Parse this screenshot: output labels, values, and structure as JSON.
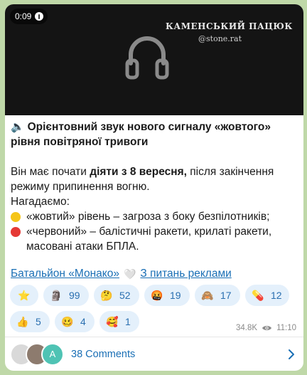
{
  "media": {
    "duration": "0:09",
    "watermark_title": "КАМЕНСЬКИЙ ПАЦЮК",
    "watermark_sub": "@stone.rat"
  },
  "post": {
    "title": "🔈 Орієнтовний звук нового сигналу «жовтого» рівня повітряної тривоги",
    "line1_pre": "Він має почати ",
    "line1_bold": "діяти з 8 вересня,",
    "line1_post": " після закінчення режиму припинення вогню.",
    "remind": "Нагадаємо:",
    "yellow_item": "«жовтий» рівень – загроза з боку безпілотників;",
    "red_item": "«червоний» – балістичні ракети, крилаті ракети, масовані атаки БПЛА.",
    "link1": "Батальйон «Монако»",
    "link2": "З питань реклами",
    "colors": {
      "yellow": "#f5c518",
      "red": "#e53935",
      "link": "#1a6fb5"
    }
  },
  "reactions": [
    {
      "emoji": "⭐",
      "count": ""
    },
    {
      "emoji": "🗿",
      "count": "99"
    },
    {
      "emoji": "🤔",
      "count": "52"
    },
    {
      "emoji": "🤬",
      "count": "19"
    },
    {
      "emoji": "🙈",
      "count": "17"
    },
    {
      "emoji": "💊",
      "count": "12"
    },
    {
      "emoji": "👍",
      "count": "5"
    },
    {
      "emoji": "🥴",
      "count": "4"
    },
    {
      "emoji": "🥰",
      "count": "1"
    }
  ],
  "meta": {
    "views": "34.8K",
    "time": "11:10"
  },
  "comments": {
    "label": "38 Comments",
    "avatar_letter": "A"
  }
}
